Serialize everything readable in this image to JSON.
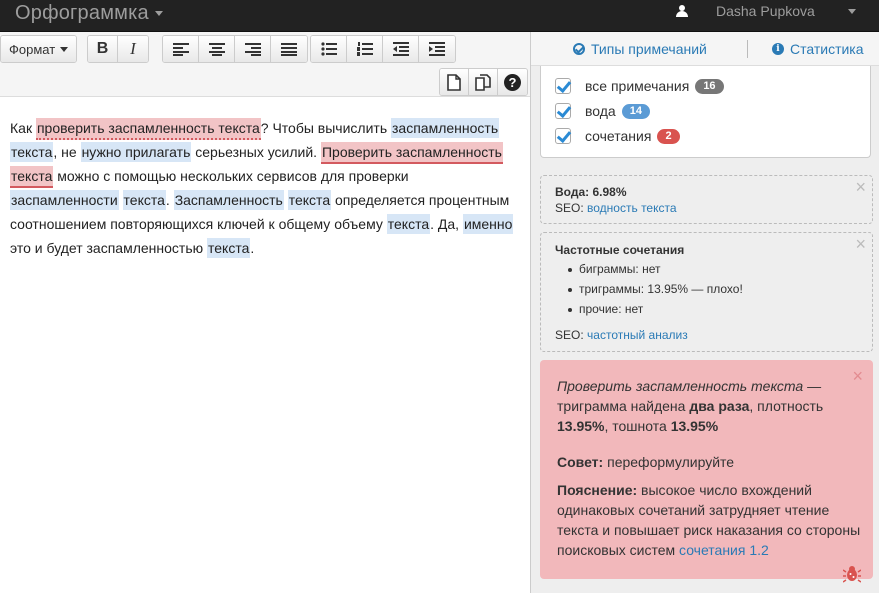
{
  "app": {
    "title": "Орфограммка",
    "user": "Dasha Pupkova"
  },
  "toolbar": {
    "format_label": "Формат",
    "bold_label": "B",
    "italic_label": "I"
  },
  "text": {
    "s01": "Как ",
    "s02": "проверить",
    "s03": " ",
    "s04": "заспамленность",
    "s05": " ",
    "s06": "текста",
    "s07": "? Чтобы вычислить ",
    "s08": "заспамленность",
    "s09": "текста",
    "s10": ", не ",
    "s11": "нужно",
    "s12": " ",
    "s13": "прилагать",
    "s14": " серьезных усилий. ",
    "s15": "Проверить заспамленность",
    "s16": "текста",
    "s17": " можно с помощью нескольких сервисов для проверки",
    "s18": "заспамленности",
    "s19": " ",
    "s20": "текста",
    "s21": ". ",
    "s22": "Заспамленность",
    "s23": " ",
    "s24": "текста",
    "s25": " определяется процентным",
    "s26": "соотношением повторяющихся ключей к общему объему ",
    "s27": "текста",
    "s28": ". Да, ",
    "s29": "именно",
    "s30": "это и будет заспамленностью ",
    "s31": "текста",
    "s32": "."
  },
  "right": {
    "tabs": {
      "types": "Типы примечаний",
      "stats": "Статистика"
    },
    "filters": [
      {
        "label": "все примечания",
        "count": "16",
        "color": "#777777"
      },
      {
        "label": "вода",
        "count": "14",
        "color": "#5b9bd5"
      },
      {
        "label": "сочетания",
        "count": "2",
        "color": "#d9534f"
      }
    ],
    "water": {
      "title": "Вода: 6.98%",
      "seo_prefix": "SEO:",
      "seo_link": "водность текста"
    },
    "freq": {
      "title": "Частотные сочетания",
      "items": [
        "биграммы: нет",
        "триграммы: 13.95% — плохо!",
        "прочие: нет"
      ],
      "seo_prefix": "SEO:",
      "seo_link": "частотный анализ"
    },
    "note": {
      "phrase": "Проверить заспамленность текста",
      "t1": " — триграмма найдена ",
      "b1": "два раза",
      "t2": ", плотность ",
      "b2": "13.95%",
      "t3": ", тошнота ",
      "b3": "13.95%",
      "advice_label": "Совет:",
      "advice_text": " переформулируйте",
      "expl_label": "Пояснение:",
      "expl_text": " высокое число вхождений одинаковых сочетаний затрудняет чтение текста и повышает риск наказания со стороны поисковых систем ",
      "expl_link": "сочетания 1.2"
    }
  }
}
